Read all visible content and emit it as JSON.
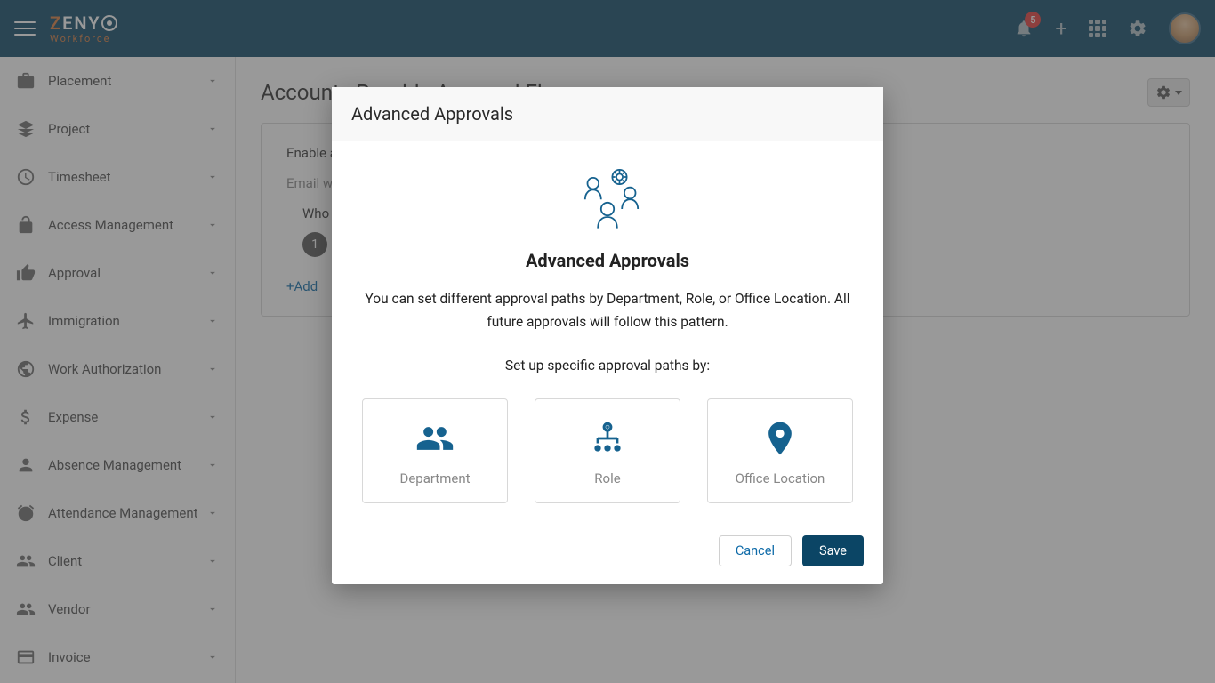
{
  "brand": {
    "name_z": "Z",
    "name_rest": "ENY",
    "sub": "Workforce"
  },
  "notifications": {
    "count": "5"
  },
  "sidebar": {
    "items": [
      {
        "label": "Placement"
      },
      {
        "label": "Project"
      },
      {
        "label": "Timesheet"
      },
      {
        "label": "Access Management"
      },
      {
        "label": "Approval"
      },
      {
        "label": "Immigration"
      },
      {
        "label": "Work Authorization"
      },
      {
        "label": "Expense"
      },
      {
        "label": "Absence Management"
      },
      {
        "label": "Attendance Management"
      },
      {
        "label": "Client"
      },
      {
        "label": "Vendor"
      },
      {
        "label": "Invoice"
      }
    ]
  },
  "page": {
    "title": "Accounts Payable Approval Flow",
    "enable_label": "Enable approval",
    "email_help": "Email will be sent to the approver(s)",
    "who_label": "Who can approve?",
    "level": "1",
    "add_link": "+Add"
  },
  "modal": {
    "header": "Advanced Approvals",
    "title": "Advanced Approvals",
    "desc": "You can set different approval paths by Department, Role, or Office Location. All future approvals will follow this pattern.",
    "sub": "Set up specific approval paths by:",
    "options": [
      {
        "label": "Department"
      },
      {
        "label": "Role"
      },
      {
        "label": "Office Location"
      }
    ],
    "cancel": "Cancel",
    "save": "Save"
  }
}
